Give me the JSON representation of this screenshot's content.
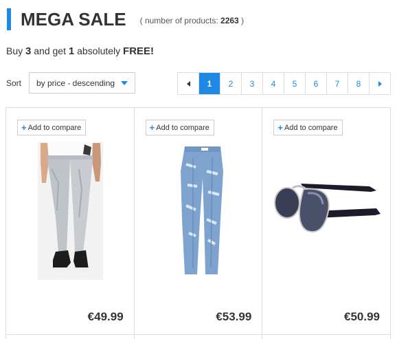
{
  "header": {
    "title": "MEGA SALE",
    "count_prefix": "( number of products:",
    "count_value": "2263",
    "count_suffix": ")",
    "accent_color": "#1e88e5"
  },
  "promo": {
    "part1": "Buy",
    "buy_qty": "3",
    "part2": "and get",
    "free_qty": "1",
    "part3": "absolutely",
    "free_word": "FREE!"
  },
  "sort": {
    "label": "Sort",
    "selected": "by price - descending"
  },
  "pagination": {
    "prev_icon": "chevron-left-icon",
    "next_icon": "chevron-right-icon",
    "pages": [
      "1",
      "2",
      "3",
      "4",
      "5",
      "6",
      "7",
      "8"
    ],
    "active_page": "1"
  },
  "products": [
    {
      "compare_label": "Add to compare",
      "price": "€49.99",
      "image": "grey-jeans-model"
    },
    {
      "compare_label": "Add to compare",
      "price": "€53.99",
      "image": "ripped-blue-jeans"
    },
    {
      "compare_label": "Add to compare",
      "price": "€50.99",
      "image": "aviator-sunglasses"
    }
  ]
}
